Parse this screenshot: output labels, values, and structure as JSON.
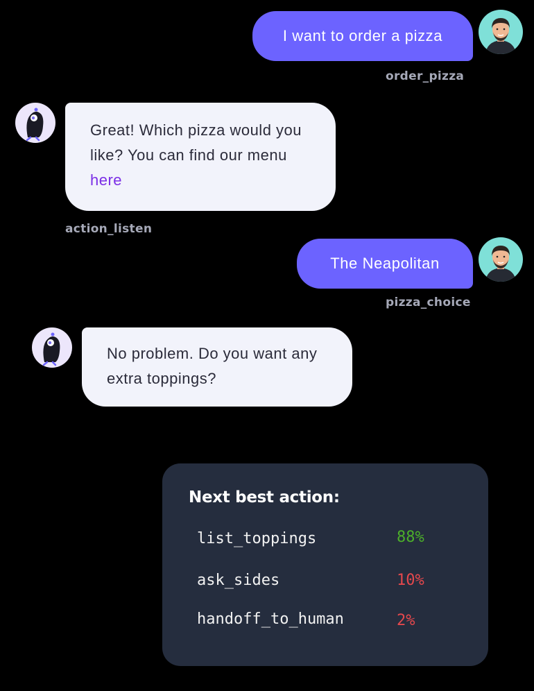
{
  "conversation": {
    "user_message_1": {
      "text": "I want to order a pizza",
      "intent": "order_pizza"
    },
    "bot_message_1": {
      "text_before_link": "Great! Which pizza would you like? You can find our menu ",
      "link_text": "here",
      "action": "action_listen"
    },
    "user_message_2": {
      "text": "The Neapolitan",
      "intent": "pizza_choice"
    },
    "bot_message_2": {
      "text": "No problem. Do you want any extra toppings?"
    }
  },
  "next_best_action": {
    "title": "Next best action:",
    "actions": [
      {
        "name": "list_toppings",
        "confidence": "88%",
        "color": "#4caf2a"
      },
      {
        "name": "ask_sides",
        "confidence": "10%",
        "color": "#e5484d"
      },
      {
        "name": "handoff_to_human",
        "confidence": "2%",
        "color": "#e5484d"
      }
    ]
  },
  "colors": {
    "user_bubble": "#6c63ff",
    "bot_bubble": "#f2f3fb",
    "link": "#7b2ee6",
    "panel_bg": "#252d3e",
    "user_avatar_bg": "#7fe0d8",
    "bot_avatar_bg": "#ece6fb"
  },
  "icons": {
    "user_avatar": "user-photo-avatar",
    "bot_avatar": "bird-mascot-icon"
  }
}
